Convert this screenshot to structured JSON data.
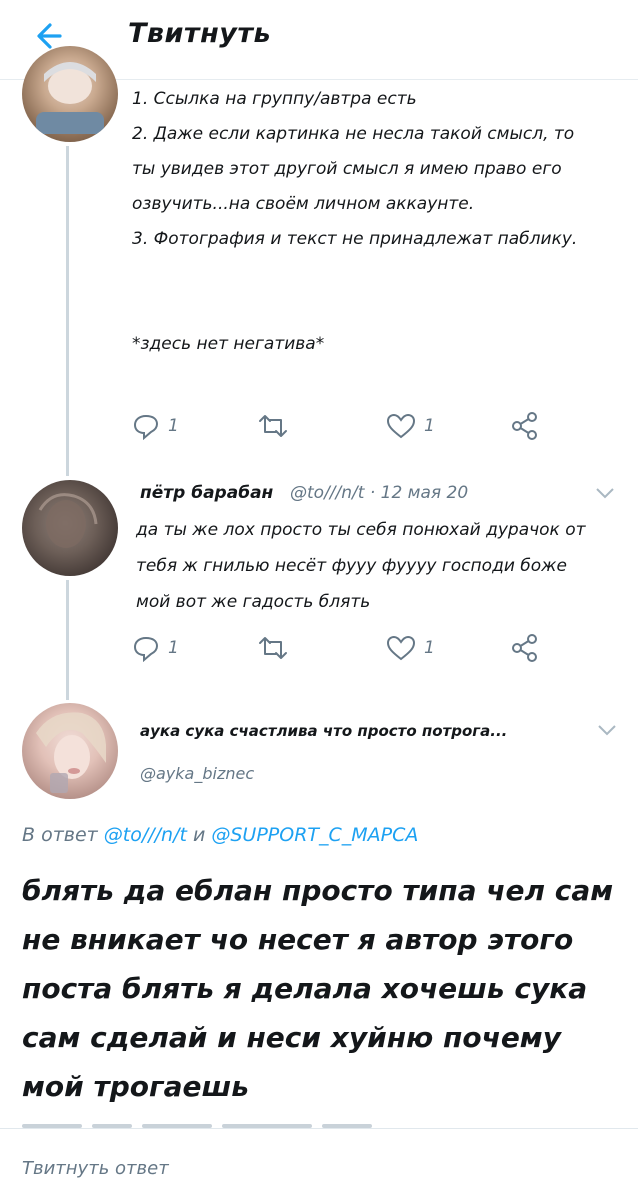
{
  "header": {
    "title": "Твитнуть"
  },
  "tweet1": {
    "text": "1. Ссылка на группу/автра есть\n2. Даже если картинка не несла такой смысл, то ты увидев этот другой смысл я имею право его озвучить...на своём личном аккаунте.\n3. Фотография и текст не принадлежат паблику.\n\n\n*здесь нет негатива*",
    "replies": "1",
    "retweets": "",
    "likes": "1"
  },
  "tweet2": {
    "name": "пётр барабан",
    "handle_date": "@to///n/t · 12 мая 20",
    "text": "да ты же лох просто ты себя понюхай дурачок от тебя ж гнилью несёт фууу фуууу господи боже мой вот же гадость блять",
    "replies": "1",
    "retweets": "",
    "likes": "1"
  },
  "main": {
    "name": "аука сука счастлива что просто потрога...",
    "handle": "@ayka_biznec",
    "reply_prefix": "В ответ ",
    "mention1": "@to///n/t",
    "reply_and": " и ",
    "mention2": "@SUPPORT_C_MAPCA",
    "text": "блять да еблан просто типа чел сам не вникает чо несет я автор этого поста блять я делала хочешь сука сам сделай и неси хуйню почему мой трогаешь"
  },
  "reply_box": {
    "placeholder": "Твитнуть ответ"
  },
  "colors": {
    "accent": "#1da1f2",
    "secondary": "#657786",
    "line": "#ccd6dd"
  },
  "icons": [
    "back-arrow-icon",
    "reply-icon",
    "retweet-icon",
    "like-icon",
    "share-icon",
    "chevron-down-icon"
  ]
}
